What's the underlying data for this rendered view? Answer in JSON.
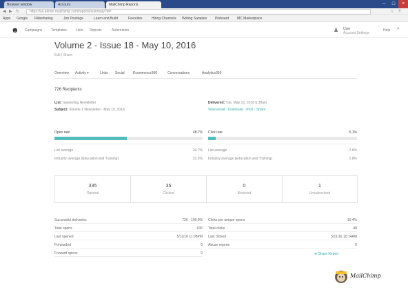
{
  "browser": {
    "tabs": [
      {
        "label": "Browser window"
      },
      {
        "label": "MailChimp Reports"
      },
      {
        "label": "Account"
      }
    ],
    "url": "https://us.admin.mailchimp.com/reports/summary?id=",
    "bookmarks": [
      "Apps",
      "Google",
      "Ridesharing",
      "Job Postings",
      "Learn and Build",
      "Favorites",
      "Hiring Channels",
      "Writing Samples",
      "Pinboard",
      "MC Marketplace"
    ]
  },
  "appbar": {
    "nav": [
      "Campaigns",
      "Templates",
      "Lists",
      "Reports",
      "Automation"
    ],
    "account_name": "User",
    "account_sub": "Account Settings",
    "help_label": "Help"
  },
  "report": {
    "title": "Volume 2 - Issue 18 - May 10, 2016",
    "subtitle": "Edit | Share",
    "tabs": [
      "Overview",
      "Activity ▾",
      "Links",
      "Social",
      "Ecommerce360",
      "Conversations",
      "Analytics360"
    ],
    "recipients_title": "726 Recipients",
    "list_label": "List:",
    "list_value": "Gardening Newsletter",
    "subject_label": "Subject:",
    "subject_value": "Volume 2 Newsletter - May 10, 2016",
    "delivered_label": "Delivered:",
    "delivered_value": "Tue, May 10, 2016 6:30am",
    "more_label": "View email · Download · Print · Share"
  },
  "stats": {
    "open": {
      "label": "Open rate",
      "value": "48.7%",
      "fraction": 0.487
    },
    "click": {
      "label": "Click rate",
      "value": "5.1%",
      "fraction": 0.051
    },
    "open_rows": [
      {
        "k": "List average",
        "v": "20.7%"
      },
      {
        "k": "Industry average (Education and Training)",
        "v": "22.6%"
      }
    ],
    "click_rows": [
      {
        "k": "List average",
        "v": "2.6%"
      },
      {
        "k": "Industry average (Education and Training)",
        "v": "2.8%"
      }
    ]
  },
  "boxes": [
    {
      "num": "335",
      "label": "Opened"
    },
    {
      "num": "35",
      "label": "Clicked"
    },
    {
      "num": "0",
      "label": "Bounced"
    },
    {
      "num": "1",
      "label": "Unsubscribed"
    }
  ],
  "details_left": [
    {
      "k": "Successful deliveries",
      "v": "726 · 100.0%"
    },
    {
      "k": "Total opens",
      "v": "636"
    },
    {
      "k": "Last opened",
      "v": "5/11/16 11:08PM"
    },
    {
      "k": "Forwarded",
      "v": "0"
    },
    {
      "k": "Forward opens",
      "v": "0"
    }
  ],
  "details_right": [
    {
      "k": "Clicks per unique opens",
      "v": "10.4%"
    },
    {
      "k": "Total clicks",
      "v": "48"
    },
    {
      "k": "Last clicked",
      "v": "5/11/16 10:14AM"
    },
    {
      "k": "Abuse reports",
      "v": "0"
    }
  ],
  "share_link": "Share Report"
}
